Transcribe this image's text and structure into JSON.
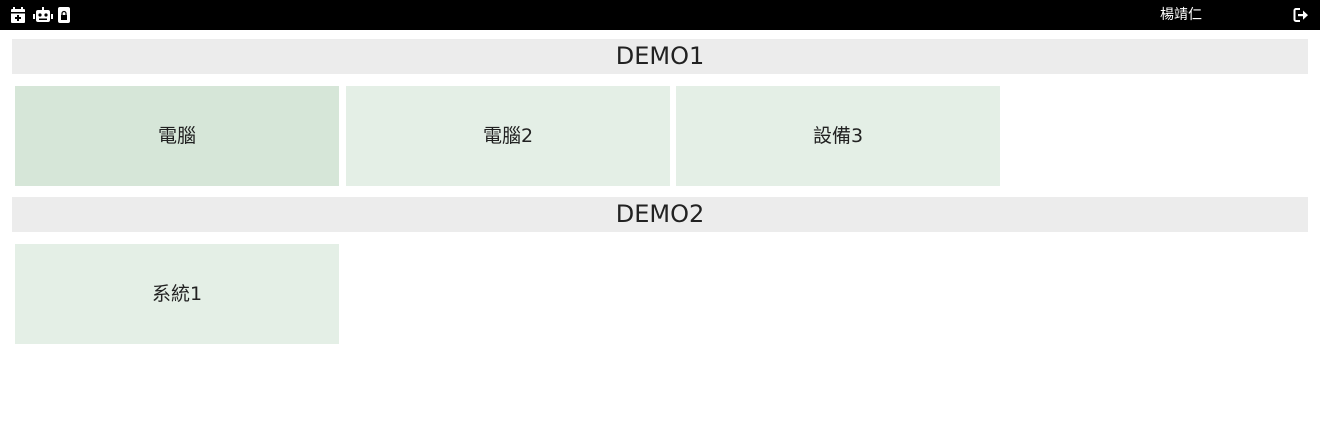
{
  "topbar": {
    "icons": [
      "calendar-add-icon",
      "robot-icon",
      "mobile-lock-icon"
    ],
    "username": "楊靖仁",
    "logout_icon": "logout-icon",
    "background": "#000000"
  },
  "sections": [
    {
      "title": "DEMO1",
      "tiles": [
        {
          "label": "電腦"
        },
        {
          "label": "電腦2"
        },
        {
          "label": "設備3"
        }
      ]
    },
    {
      "title": "DEMO2",
      "tiles": [
        {
          "label": "系統1"
        }
      ]
    }
  ],
  "colors": {
    "header_bg": "#ececec",
    "tile_bg": "#e4efe6",
    "tile_active_bg": "#d6e6d8"
  }
}
